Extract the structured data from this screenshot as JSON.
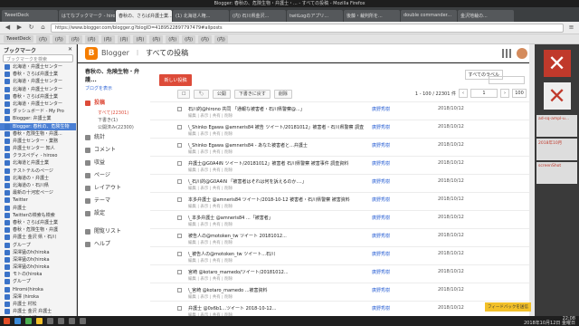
{
  "window": {
    "title": "Blogger: 春秋の、危険生物・弁護士・... - すべての投稿 - Mozilla Firefox"
  },
  "tabs": [
    {
      "label": "TweetDeck"
    },
    {
      "label": "はてなブックマーク - hiro..."
    },
    {
      "label": "春秋の、さらば弁護士業..."
    },
    {
      "label": "(1) 北海道人権... "
    },
    {
      "label": "(内) 石川県金沢..."
    },
    {
      "label": "twitLogのアプリ..."
    },
    {
      "label": "後藤・裁判所を..."
    },
    {
      "label": "double commander..."
    },
    {
      "label": "金沢地裁の..."
    }
  ],
  "nav": {
    "url": "https://www.blogger.com/blogger.g?blogID=4189522897797479#allposts"
  },
  "bookmark_toolbar": [
    "TweetDeck",
    "(内)",
    "(内)",
    "(内)",
    "(内)",
    "(内)",
    "(内)",
    "(内)",
    "(内)",
    "(内)",
    "(内)",
    "(内)",
    "(内)"
  ],
  "sidebar": {
    "title": "ブックマーク",
    "search_placeholder": "ブックマークを検索",
    "items": [
      "北海道・弁護士センター",
      "春秋・さらば弁護士業",
      "北海道・弁護士センター",
      "北海道・弁護士センター",
      "春秋・さらば弁護士業",
      "北海道・弁護士センター",
      "ダッシュボード - My Pro",
      "Blogger: 弁護士業",
      "Blogger: 春秋の、危険生物",
      "春秋・危険生物・弁護...",
      "弁護士センター・業務",
      "弁護士センター 知人",
      "クラスペディ - hiroso",
      "北海道と弁護士業",
      "テストテルのページ",
      "北海道の・弁護士",
      "北海道の・石川県",
      "最新の十河宏ページ",
      "Twitter",
      "弁護士",
      "Twitterの検索も検索",
      "春秋・さらば弁護士業",
      "春秋・危険生物・弁護",
      "弁護士 金沢 県・石川",
      "グループ",
      "深澤猛のh(hiroka",
      "深澤猛のh(hiroka",
      "深澤猛のh(hiroka",
      "モトの(hiroka",
      "グループ",
      "Hiromi(hiroka",
      "深澤 (hiroka",
      "弁護士 村松",
      "弁護士 金沢 弁護士",
      "弁護士 金沢 さらば"
    ]
  },
  "blogger": {
    "brand": "Blogger",
    "section": "すべての投稿",
    "blog_title": "春秋の、危険生物・弁護...",
    "view_blog": "ブログを表示",
    "new_post": "新しい投稿",
    "nav": [
      {
        "label": "投稿",
        "active": true
      },
      {
        "label": "統計"
      },
      {
        "label": "コメント"
      },
      {
        "label": "収益"
      },
      {
        "label": "ページ"
      },
      {
        "label": "レイアウト"
      },
      {
        "label": "テーマ"
      },
      {
        "label": "設定"
      },
      {
        "label": "閲覧リスト"
      },
      {
        "label": "ヘルプ"
      }
    ],
    "sub_nav": [
      {
        "label": "すべて(22301)",
        "active": true
      },
      {
        "label": "下書き(1)"
      },
      {
        "label": "公開済み(22300)"
      }
    ],
    "top_select": "すべてのラベル",
    "toolbar": {
      "btn1": "公開",
      "btn2": "下書きに戻す",
      "btn3": "削除"
    },
    "pager": {
      "range": "1 - 100 / 22301 件",
      "page": "1",
      "per_page": "100"
    },
    "posts": [
      {
        "title": "石川的@hirono 共同 「通報な被害者・石川県警察@...」",
        "author": "廣野秀樹",
        "pin": "",
        "comments": "",
        "date": "2018/10/12"
      },
      {
        "title": "\\_Shinko Egawa @amneris84 被告 ツイート/20181012」被害者・石川県警察 調査 -- 被害者",
        "author": "廣野秀樹",
        "pin": "",
        "comments": "",
        "date": "2018/10/12"
      },
      {
        "title": "\\_Shinko Egawa @amneris84 - あなた被害者と...弁護士",
        "author": "廣野秀樹",
        "pin": "",
        "comments": "",
        "date": "2018/10/12"
      },
      {
        "title": "弁護士@G0A4iN ツイート/20181012」被害者 石川県警察 被害事件 調査資料",
        "author": "廣野秀樹",
        "pin": "",
        "comments": "",
        "date": "2018/10/12"
      },
      {
        "title": "\\_石川的@G0A4iN 「被害者はそれは何を訴えるのか....」",
        "author": "廣野秀樹",
        "pin": "",
        "comments": "",
        "date": "2018/10/12"
      },
      {
        "title": "本多弁護士 @amneris84 ツイート/2018-10-12 被害者・石川県警察 被害資料",
        "author": "廣野秀樹",
        "pin": "",
        "comments": "",
        "date": "2018/10/12"
      },
      {
        "title": "\\_本多弁護士 @amneris84 ...「被害者」",
        "author": "廣野秀樹",
        "pin": "",
        "comments": "",
        "date": "2018/10/12"
      },
      {
        "title": "被告人の@motoken_tw ツイート 20181012...",
        "author": "廣野秀樹",
        "pin": "",
        "comments": "",
        "date": "2018/10/12"
      },
      {
        "title": "\\_被告人の@motoken_tw ツイート...石川",
        "author": "廣野秀樹",
        "pin": "",
        "comments": "",
        "date": "2018/10/12"
      },
      {
        "title": "宮崎 @kotaro_mamedo/ツイート/20181012...",
        "author": "廣野秀樹",
        "pin": "",
        "comments": "",
        "date": "2018/10/12"
      },
      {
        "title": "\\_宮崎 @kotaro_mamedo ...被害資料",
        "author": "廣野秀樹",
        "pin": "",
        "comments": "",
        "date": "2018/10/12"
      },
      {
        "title": "弁護士 @0x6b1...ツイート 2018-10-12...",
        "author": "廣野秀樹",
        "pin": "",
        "comments": "",
        "date": "2018/10/12"
      }
    ],
    "row_actions": "編集 | 表示 | 共有 | 削除"
  },
  "right_panel": {
    "shots": [
      "ad-sq-ampl-u...",
      "2018年10月",
      "screenShot"
    ]
  },
  "feedback": "フィードバックを送信",
  "clock": {
    "time": "22:08",
    "date": "2018年10月12日 金曜日"
  }
}
